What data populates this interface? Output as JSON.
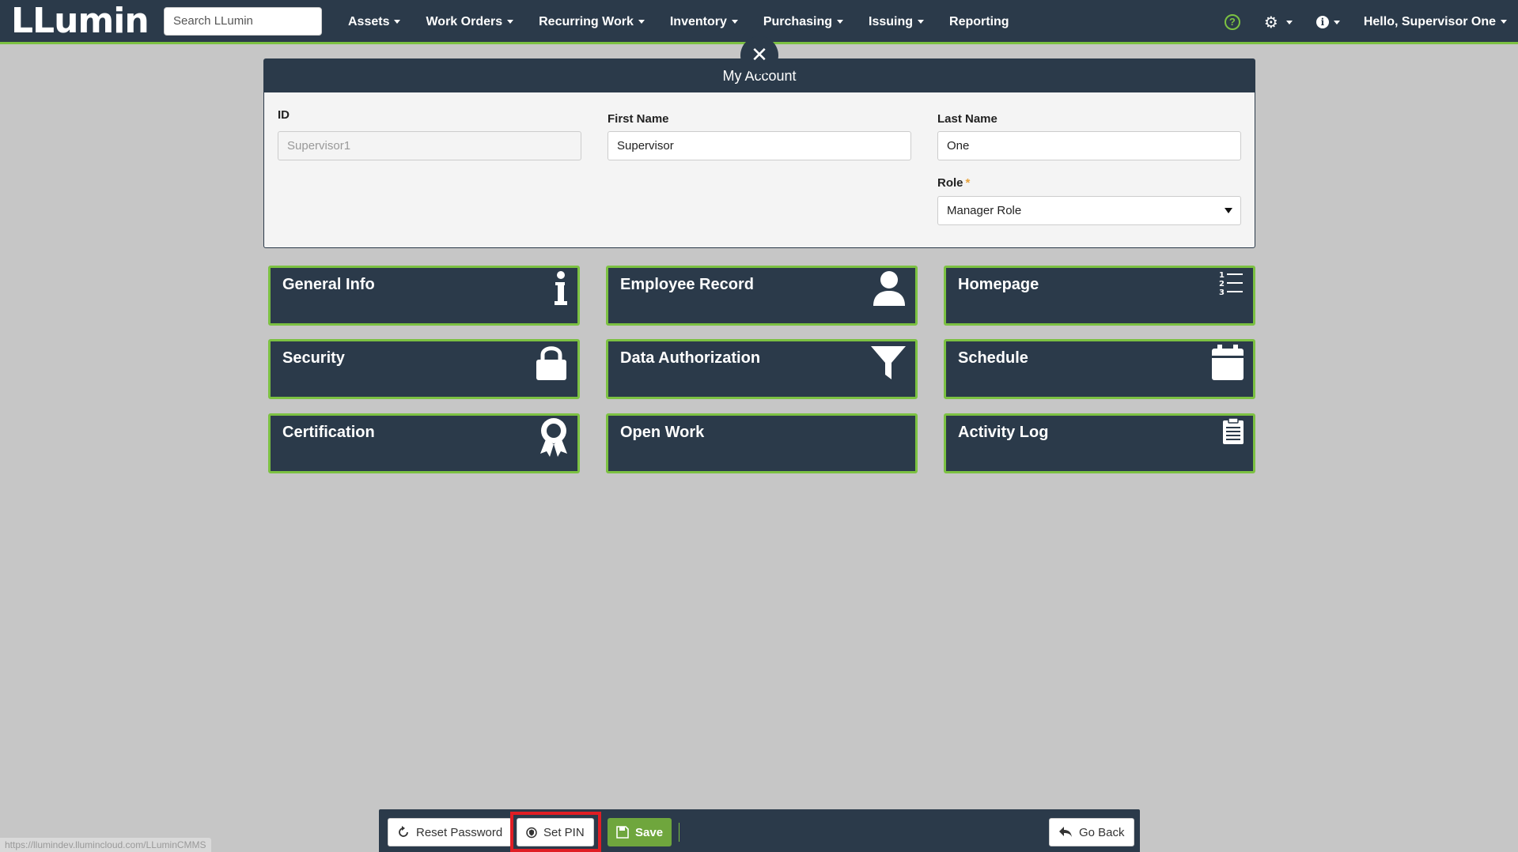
{
  "nav": {
    "logo": "LLumin",
    "search_placeholder": "Search LLumin",
    "menu": [
      "Assets",
      "Work Orders",
      "Recurring Work",
      "Inventory",
      "Purchasing",
      "Issuing",
      "Reporting"
    ],
    "user_greeting": "Hello, Supervisor One"
  },
  "account": {
    "title": "My Account",
    "id_label": "ID",
    "id_value": "Supervisor1",
    "first_name_label": "First Name",
    "first_name_value": "Supervisor",
    "last_name_label": "Last Name",
    "last_name_value": "One",
    "role_label": "Role",
    "role_required": "*",
    "role_value": "Manager Role"
  },
  "tiles": [
    {
      "label": "General Info",
      "icon": "info-icon"
    },
    {
      "label": "Employee Record",
      "icon": "user-icon"
    },
    {
      "label": "Homepage",
      "icon": "list-ordered-icon"
    },
    {
      "label": "Security",
      "icon": "lock-icon"
    },
    {
      "label": "Data Authorization",
      "icon": "filter-icon"
    },
    {
      "label": "Schedule",
      "icon": "calendar-icon"
    },
    {
      "label": "Certification",
      "icon": "award-icon"
    },
    {
      "label": "Open Work",
      "icon": ""
    },
    {
      "label": "Activity Log",
      "icon": "clipboard-icon"
    }
  ],
  "toolbar": {
    "reset_password": "Reset Password",
    "set_pin": "Set PIN",
    "save": "Save",
    "go_back": "Go Back"
  },
  "status_url": "https://llumindev.llumincloud.com/LLuminCMMS",
  "colors": {
    "navy": "#2b3a4a",
    "accent_green": "#7cc142",
    "highlight_red": "#e01e24"
  }
}
